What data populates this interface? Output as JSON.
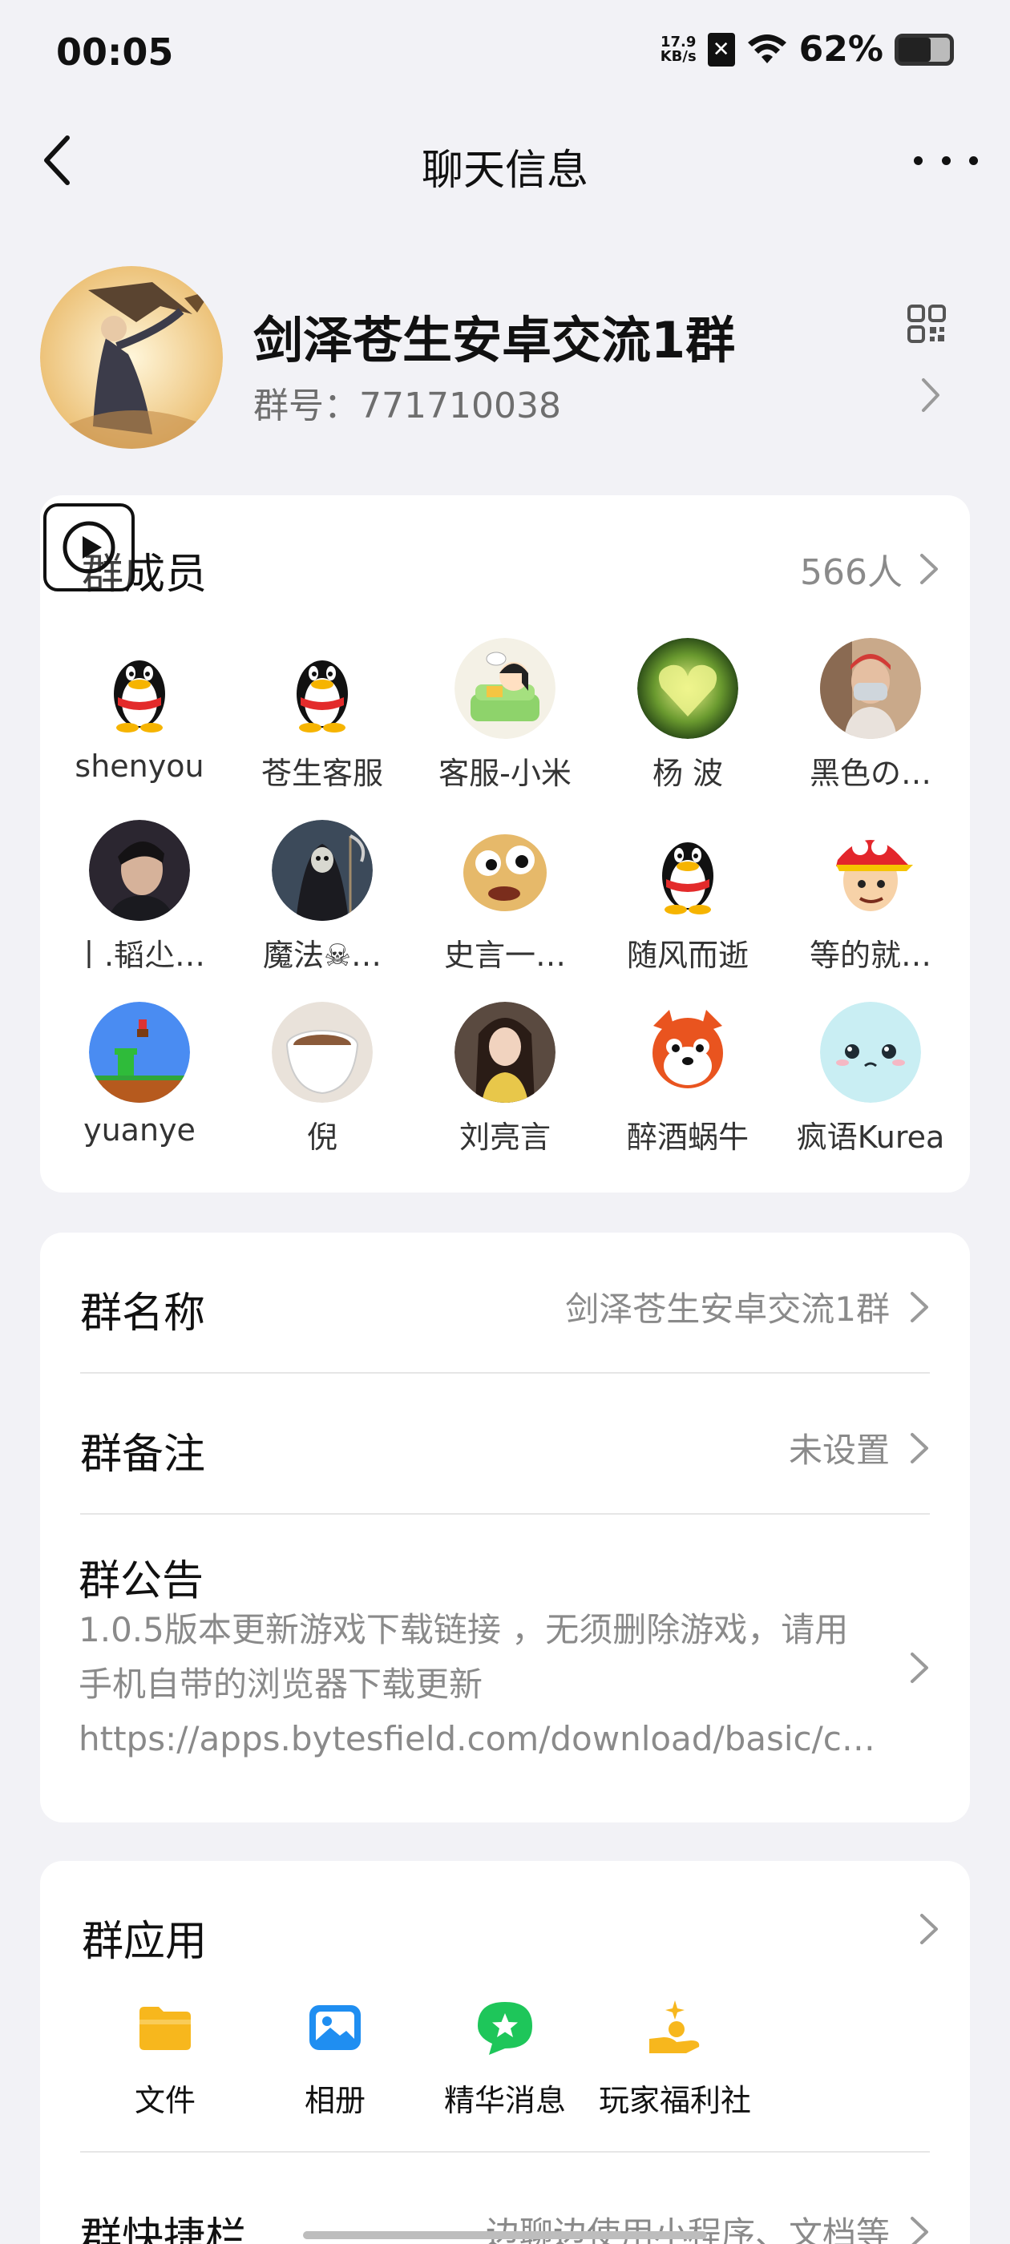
{
  "status_bar": {
    "time": "00:05",
    "net_speed_value": "17.9",
    "net_speed_unit": "KB/s",
    "battery_percent": "62%",
    "battery_level": 0.62
  },
  "nav": {
    "title": "聊天信息"
  },
  "group": {
    "name": "剑泽苍生安卓交流1群",
    "id_text": "群号：771710038"
  },
  "members": {
    "title": "群成员",
    "count": "566人",
    "items": [
      {
        "name": "shenyou",
        "avatar": "penguin"
      },
      {
        "name": "苍生客服",
        "avatar": "penguin"
      },
      {
        "name": "客服-小米",
        "avatar": "cartoon-girl-sofa"
      },
      {
        "name": "杨 波",
        "avatar": "green-heart"
      },
      {
        "name": "黑色の…",
        "avatar": "masked-man"
      },
      {
        "name": "丨.韬尐…",
        "avatar": "young-man"
      },
      {
        "name": "魔法☠…",
        "avatar": "grim-reaper"
      },
      {
        "name": "史言一…",
        "avatar": "funny-face"
      },
      {
        "name": "随风而逝",
        "avatar": "penguin"
      },
      {
        "name": "等的就…",
        "avatar": "cartoon-cap-boy"
      },
      {
        "name": "yuanye",
        "avatar": "pixel-game"
      },
      {
        "name": "倪",
        "avatar": "coffee-cup"
      },
      {
        "name": "刘亮言",
        "avatar": "girl-photo"
      },
      {
        "name": "醉酒蜗牛",
        "avatar": "cartoon-chipmunk"
      },
      {
        "name": "疯语Kurea",
        "avatar": "cute-blob"
      }
    ]
  },
  "info": {
    "group_name_label": "群名称",
    "group_name_value": "剑泽苍生安卓交流1群",
    "remark_label": "群备注",
    "remark_value": "未设置",
    "notice_label": "群公告",
    "notice_lines": [
      "1.0.5版本更新游戏下载链接 ，无须删除游戏，请用",
      "手机自带的浏览器下载更新",
      "https://apps.bytesfield.com/download/basic/c…"
    ]
  },
  "apps": {
    "title": "群应用",
    "items": [
      {
        "label": "文件",
        "icon": "folder-icon",
        "color": "#f7b71d"
      },
      {
        "label": "相册",
        "icon": "photo-icon",
        "color": "#1f8ef1"
      },
      {
        "label": "精华消息",
        "icon": "star-bubble-icon",
        "color": "#1ec65a"
      },
      {
        "label": "玩家福利社",
        "icon": "gift-hand-icon",
        "color": "#f7b71d"
      }
    ],
    "shortcut_label": "群快捷栏",
    "shortcut_value": "边聊边使用小程序、文档等"
  }
}
